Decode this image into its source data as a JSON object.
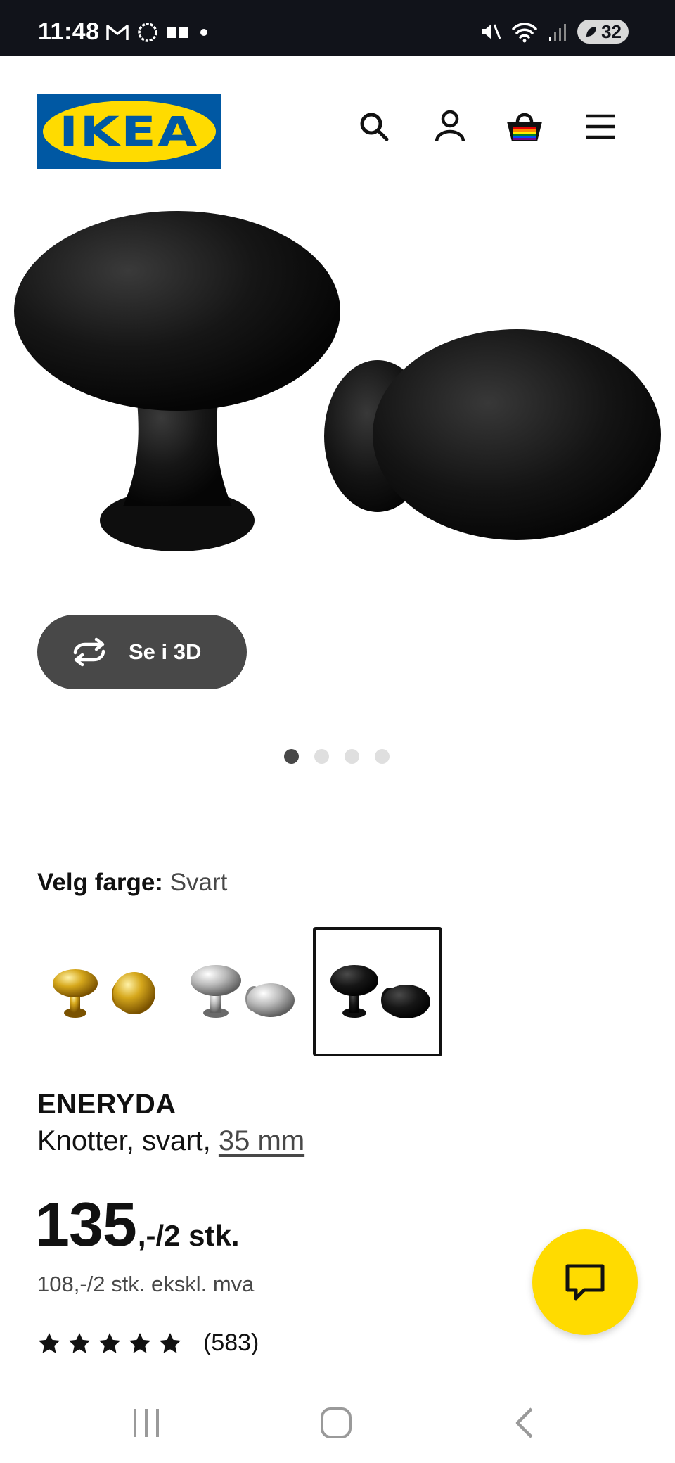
{
  "status_bar": {
    "time": "11:48",
    "battery": "32",
    "left_icons": [
      "gmail-icon",
      "messenger-icon",
      "card-icon",
      "dot-icon"
    ],
    "right_icons": [
      "mute-icon",
      "wifi-icon",
      "signal-icon",
      "battery-icon"
    ]
  },
  "header": {
    "logo_text": "IKEA",
    "icons": [
      "search-icon",
      "profile-icon",
      "basket-icon",
      "menu-icon"
    ]
  },
  "hero": {
    "view3d_label": "Se i 3D",
    "carousel_total": 4,
    "carousel_active": 1
  },
  "color_picker": {
    "label": "Velg farge:",
    "value": "Svart",
    "options": [
      "gold",
      "chrome",
      "black"
    ],
    "selected": "black"
  },
  "product": {
    "name": "ENERYDA",
    "desc_text": "Knotter, svart, ",
    "desc_measure": "35 mm",
    "price_integer": "135",
    "price_suffix": ",-/2 stk.",
    "price_ex_vat": "108,-/2 stk. ekskl. mva",
    "rating_count": "(583)",
    "rating_stars": 5
  },
  "colors": {
    "brand_blue": "#0058a3",
    "brand_yellow": "#ffdb00",
    "button_grey": "#484848"
  }
}
